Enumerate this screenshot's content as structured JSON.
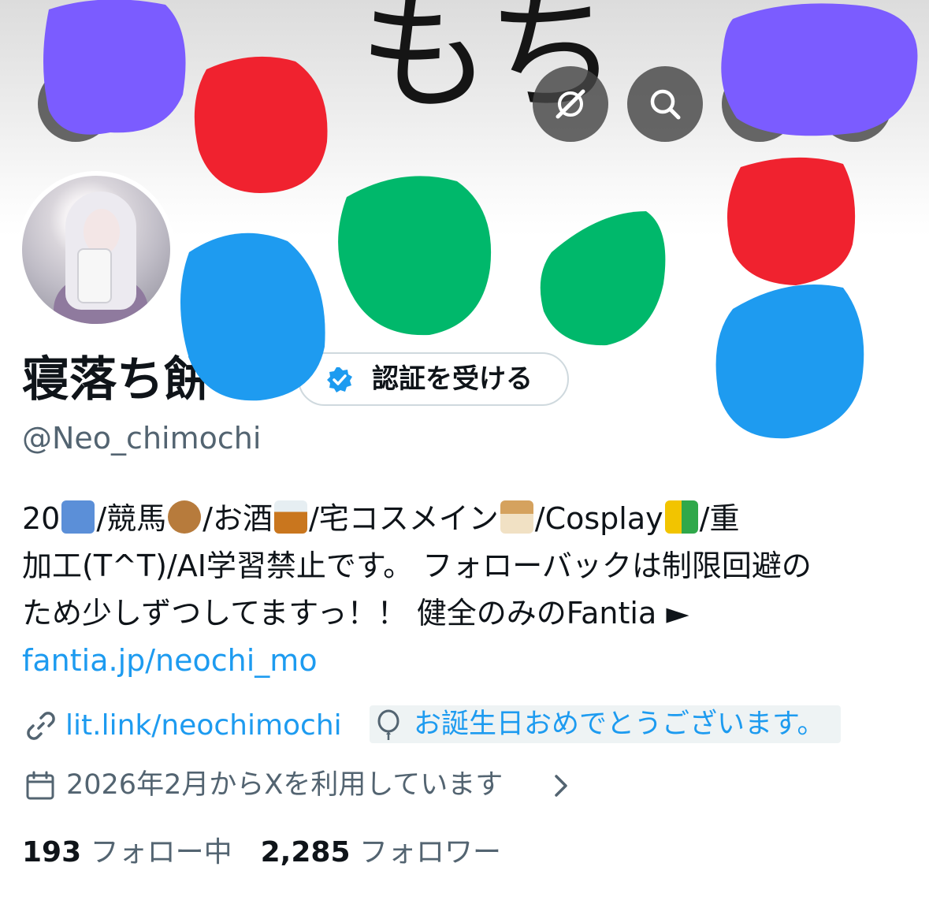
{
  "banner": {
    "text": "もち"
  },
  "header_buttons": [
    {
      "name": "back-button",
      "icon": "arrow-left-icon"
    },
    {
      "name": "grok-button",
      "icon": "grok-icon"
    },
    {
      "name": "search-button",
      "icon": "search-icon"
    },
    {
      "name": "share-button",
      "icon": "share-icon"
    },
    {
      "name": "more-button",
      "icon": "more-icon"
    }
  ],
  "profile": {
    "display_name": "寝落ち餅",
    "handle": "@Neo_chimochi",
    "verify_button_label": "認証を受ける"
  },
  "bio": {
    "line1_parts": [
      "20",
      "/競馬",
      "/お酒",
      "/宅コスメイン",
      "/Cosplay",
      "/重"
    ],
    "line2": "加工(T^T)/AI学習禁止です。 フォローバックは制限回避の",
    "line3": "ため少しずつしてますっ！！ 健全のみのFantia ►",
    "link": "fantia.jp/neochi_mo"
  },
  "profile_link": {
    "url": "lit.link/neochimochi",
    "icon": "link-icon"
  },
  "birthday": {
    "text": "お誕生日おめでとうございます。",
    "icon": "balloon-icon"
  },
  "joined": {
    "text": "2026年2月からXを利用しています",
    "icon": "calendar-icon"
  },
  "stats": {
    "following_count": "193",
    "following_label": "フォロー中",
    "followers_count": "2,285",
    "followers_label": "フォロワー"
  },
  "colors": {
    "accent": "#1d9bf0",
    "secondary_text": "#536471",
    "border": "#cfd9de",
    "redaction_purple": "#7b5cff",
    "redaction_red": "#f0222f",
    "redaction_green": "#00b86b",
    "redaction_blue": "#1e9bf0"
  }
}
